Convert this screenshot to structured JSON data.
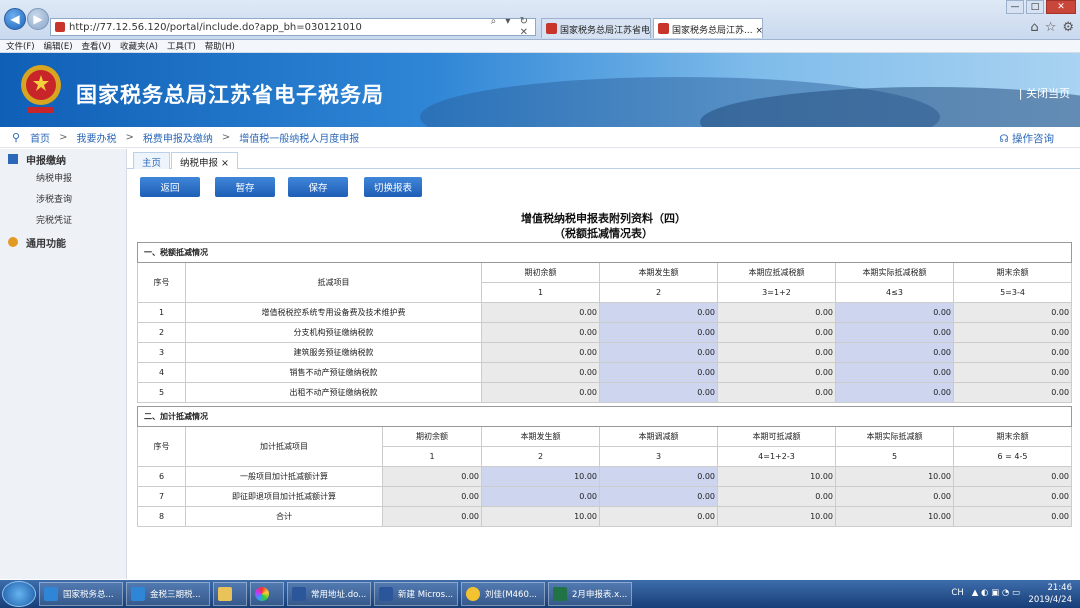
{
  "browser": {
    "url": "http://77.12.56.120/portal/include.do?app_bh=030121010",
    "address_controls": "⌕ ▾ ↻ ✕",
    "tabs": [
      "国家税务总局江苏省电...",
      "国家税务总局江苏... ×"
    ],
    "window_controls": [
      "—",
      "□",
      "✕"
    ]
  },
  "menubar": [
    "文件(F)",
    "编辑(E)",
    "查看(V)",
    "收藏夹(A)",
    "工具(T)",
    "帮助(H)"
  ],
  "banner": {
    "title": "国家税务总局江苏省电子税务局",
    "close_label": "| 关闭当页"
  },
  "breadcrumb": [
    "首页",
    "我要办税",
    "税费申报及缴纳",
    "增值税一般纳税人月度申报"
  ],
  "help_label": "操作咨询",
  "sidebar": {
    "section1": "申报缴纳",
    "items": [
      "纳税申报",
      "涉税查询",
      "完税凭证"
    ],
    "section2": "通用功能"
  },
  "page_tabs": [
    "主页",
    "纳税申报 ×"
  ],
  "buttons": [
    "返回",
    "暂存",
    "保存",
    "切换报表"
  ],
  "form": {
    "title": "增值税纳税申报表附列资料（四）",
    "subtitle": "（税额抵减情况表）"
  },
  "section1": {
    "title": "一、税额抵减情况",
    "col_seq": "序号",
    "col_item": "抵减项目",
    "cols": [
      "期初余额",
      "本期发生额",
      "本期应抵减税额",
      "本期实际抵减税额",
      "期末余额"
    ],
    "formulas": [
      "1",
      "2",
      "3=1+2",
      "4≤3",
      "5=3-4"
    ],
    "rows": [
      {
        "seq": "1",
        "item": "增值税税控系统专用设备费及技术维护费",
        "values": [
          "0.00",
          "0.00",
          "0.00",
          "0.00",
          "0.00"
        ]
      },
      {
        "seq": "2",
        "item": "分支机构预征缴纳税款",
        "values": [
          "0.00",
          "0.00",
          "0.00",
          "0.00",
          "0.00"
        ]
      },
      {
        "seq": "3",
        "item": "建筑服务预征缴纳税款",
        "values": [
          "0.00",
          "0.00",
          "0.00",
          "0.00",
          "0.00"
        ]
      },
      {
        "seq": "4",
        "item": "销售不动产预征缴纳税款",
        "values": [
          "0.00",
          "0.00",
          "0.00",
          "0.00",
          "0.00"
        ]
      },
      {
        "seq": "5",
        "item": "出租不动产预征缴纳税款",
        "values": [
          "0.00",
          "0.00",
          "0.00",
          "0.00",
          "0.00"
        ]
      }
    ]
  },
  "section2": {
    "title": "二、加计抵减情况",
    "col_seq": "序号",
    "col_item": "加计抵减项目",
    "cols": [
      "期初余额",
      "本期发生额",
      "本期调减额",
      "本期可抵减额",
      "本期实际抵减额",
      "期末余额"
    ],
    "formulas": [
      "1",
      "2",
      "3",
      "4=1+2-3",
      "5",
      "6 = 4-5"
    ],
    "rows": [
      {
        "seq": "6",
        "item": "一般项目加计抵减额计算",
        "values": [
          "0.00",
          "10.00",
          "0.00",
          "10.00",
          "10.00",
          "0.00"
        ]
      },
      {
        "seq": "7",
        "item": "即征即退项目加计抵减额计算",
        "values": [
          "0.00",
          "0.00",
          "0.00",
          "0.00",
          "0.00",
          "0.00"
        ]
      },
      {
        "seq": "8",
        "item": "合计",
        "values": [
          "0.00",
          "10.00",
          "0.00",
          "10.00",
          "10.00",
          "0.00"
        ]
      }
    ]
  },
  "taskbar": {
    "items": [
      "国家税务总...",
      "金税三期税...",
      "",
      "",
      "常用地址.do...",
      "新建 Micros...",
      "刘佳(M460...",
      "2月申报表.x..."
    ],
    "tray_lang": "CH",
    "tray_symbols": "▲ ◐ ▣ ◔ ▭",
    "time": "21:46",
    "date": "2019/4/24"
  }
}
